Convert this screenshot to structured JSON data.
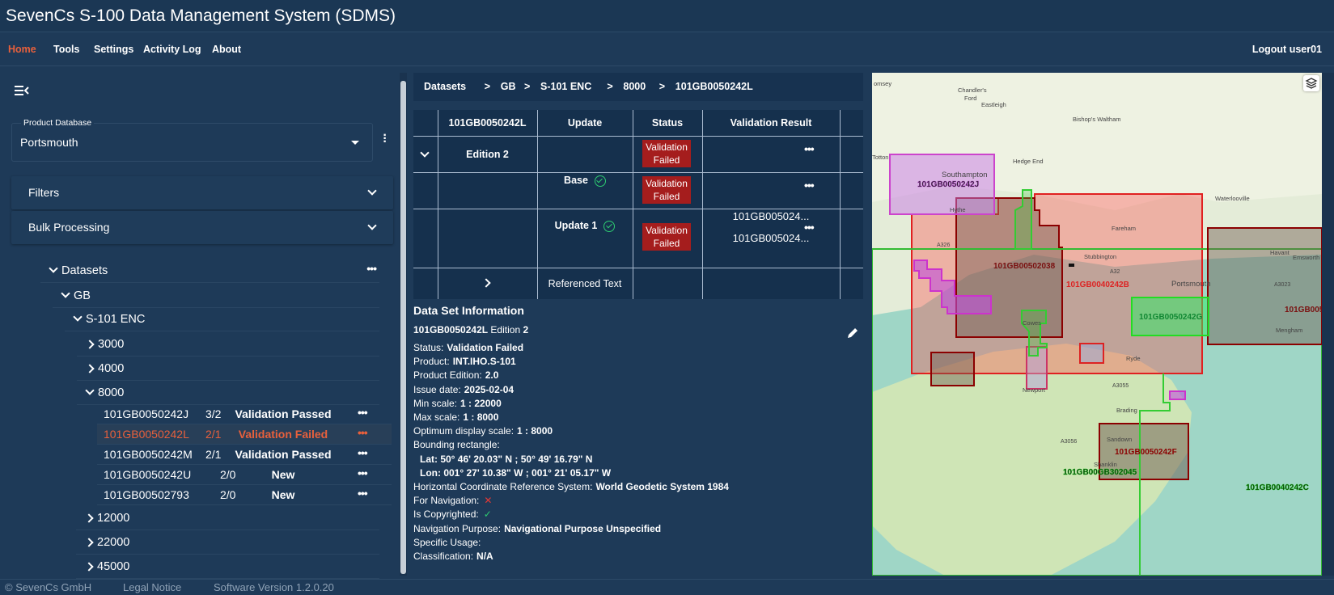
{
  "app": {
    "title": "SevenCs S-100 Data Management System (SDMS)"
  },
  "nav": {
    "items": [
      "Home",
      "Tools",
      "Settings",
      "Activity Log",
      "About"
    ],
    "active": "Home",
    "logout": "Logout user01"
  },
  "sidebar": {
    "product_db": {
      "label": "Product Database",
      "value": "Portsmouth"
    },
    "filters": "Filters",
    "bulk": "Bulk Processing",
    "tree": [
      {
        "label": "Datasets",
        "level": 0,
        "expanded": true,
        "dots": true
      },
      {
        "label": "GB",
        "level": 1,
        "expanded": true
      },
      {
        "label": "S-101 ENC",
        "level": 2,
        "expanded": true
      },
      {
        "label": "3000",
        "level": 3,
        "expanded": false
      },
      {
        "label": "4000",
        "level": 3,
        "expanded": false
      },
      {
        "label": "8000",
        "level": 3,
        "expanded": true
      }
    ],
    "datasets": [
      {
        "name": "101GB0050242J",
        "count": "3/2",
        "status": "Validation Passed",
        "selected": false
      },
      {
        "name": "101GB0050242L",
        "count": "2/1",
        "status": "Validation Failed",
        "selected": true
      },
      {
        "name": "101GB0050242M",
        "count": "2/1",
        "status": "Validation Passed",
        "selected": false
      },
      {
        "name": "101GB0050242U",
        "count": "2/0",
        "status": "New",
        "selected": false
      },
      {
        "name": "101GB00502793",
        "count": "2/0",
        "status": "New",
        "selected": false
      }
    ],
    "tree_after": [
      "12000",
      "22000",
      "45000"
    ]
  },
  "breadcrumb": [
    "Datasets",
    "GB",
    "S-101 ENC",
    "8000",
    "101GB0050242L"
  ],
  "table": {
    "headers": [
      "101GB0050242L",
      "Update",
      "Status",
      "Validation Result"
    ],
    "edition": "Edition 2",
    "edition_status": "Validation Failed",
    "base": "Base",
    "base_status": "Validation Failed",
    "update1": "Update 1",
    "update1_status": "Validation Failed",
    "update1_results": [
      "101GB005024...",
      "101GB005024..."
    ],
    "referenced": "Referenced Text"
  },
  "info": {
    "title": "Data Set Information",
    "id": "101GB0050242L",
    "edition_label": "Edition",
    "edition": "2",
    "lines": [
      {
        "k": "Status:",
        "v": "Validation Failed"
      },
      {
        "k": "Product:",
        "v": "INT.IHO.S-101"
      },
      {
        "k": "Product Edition:",
        "v": "2.0"
      },
      {
        "k": "Issue date:",
        "v": "2025-02-04"
      },
      {
        "k": "Min scale:",
        "v": "1 : 22000"
      },
      {
        "k": "Max scale:",
        "v": "1 : 8000"
      },
      {
        "k": "Optimum display scale:",
        "v": "1 : 8000"
      },
      {
        "k": "Bounding rectangle:",
        "v": ""
      },
      {
        "k": "",
        "v": "Lat: 50° 46' 20.03\" N ; 50° 49' 16.79\" N"
      },
      {
        "k": "",
        "v": "Lon: 001° 27' 10.38\" W ; 001° 21' 05.17\" W"
      },
      {
        "k": "Horizontal Coordinate Reference System:",
        "v": "World Geodetic System 1984"
      },
      {
        "k": "For Navigation:",
        "v": "",
        "icon": "cross"
      },
      {
        "k": "Is Copyrighted:",
        "v": "",
        "icon": "check"
      },
      {
        "k": "Navigation Purpose:",
        "v": "Navigational Purpose Unspecified"
      },
      {
        "k": "Specific Usage:",
        "v": ""
      },
      {
        "k": "Classification:",
        "v": "N/A"
      }
    ]
  },
  "map": {
    "places": [
      "omsey",
      "Chandler's",
      "Ford",
      "Eastleigh",
      "Bishop's Waltham",
      "Hedge End",
      "Totton",
      "Southampton",
      "Hythe",
      "Waterlooville",
      "Fareham",
      "Stubbington",
      "Portsmouth",
      "Cowes",
      "Newport",
      "Ryde",
      "Brading",
      "Sandown",
      "Shanklin",
      "Havant",
      "Emsworth",
      "Mengham",
      "A326",
      "A32",
      "A3055",
      "A3056",
      "A3023"
    ],
    "datasets": [
      "101GB0050242J",
      "101GB00502038",
      "101GB0040242B",
      "101GB0050242G",
      "101GB0050242F",
      "101GB00GB302045",
      "101GB0040242C",
      "101GB005"
    ]
  },
  "footer": {
    "copyright": "© SevenCs GmbH",
    "legal": "Legal Notice",
    "version": "Software Version 1.2.0.20"
  },
  "colors": {
    "accent": "#e8603c",
    "fail": "#a51d1d",
    "ok": "#2ecc71"
  }
}
